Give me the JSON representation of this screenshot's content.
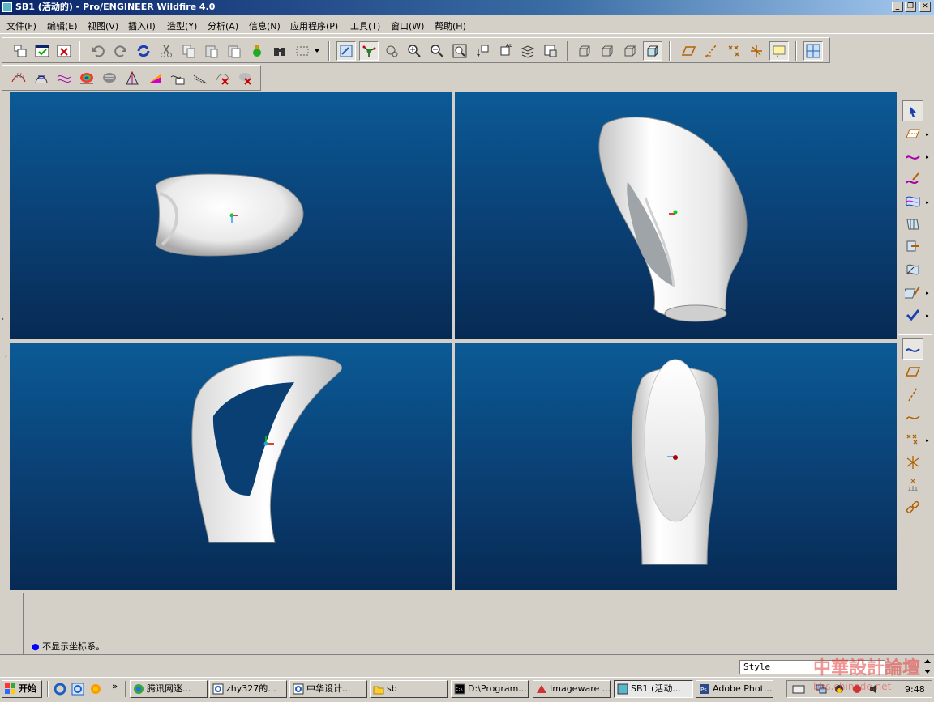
{
  "window": {
    "title": "SB1 (活动的) - Pro/ENGINEER Wildfire 4.0"
  },
  "menu": [
    {
      "label": "文件(F)"
    },
    {
      "label": "编辑(E)"
    },
    {
      "label": "视图(V)"
    },
    {
      "label": "插入(I)"
    },
    {
      "label": "造型(Y)"
    },
    {
      "label": "分析(A)"
    },
    {
      "label": "信息(N)"
    },
    {
      "label": "应用程序(P)"
    },
    {
      "label": "工具(T)"
    },
    {
      "label": "窗口(W)"
    },
    {
      "label": "帮助(H)"
    }
  ],
  "toolbar_main": [
    "new-window-icon",
    "save-icon",
    "close-window-icon",
    "undo-icon",
    "redo-icon",
    "regenerate-icon",
    "cut-icon",
    "copy-icon",
    "paste-icon",
    "paste-special-icon",
    "model-tree-icon",
    "find-icon",
    "select-box-icon",
    "repaint-icon",
    "spin-center-icon",
    "orient-icon",
    "zoom-in-icon",
    "zoom-out-icon",
    "refit-icon",
    "reorient-icon",
    "saved-views-icon",
    "layers-icon",
    "view-manager-icon",
    "wireframe-icon",
    "hidden-line-icon",
    "no-hidden-icon",
    "shaded-icon",
    "datum-planes-icon",
    "datum-axes-icon",
    "datum-points-icon",
    "datum-csys-icon",
    "annotations-icon",
    "multi-view-icon"
  ],
  "toolbar_analysis": [
    "curvature-icon",
    "section-icon",
    "offset-icon",
    "shaded-curvature-icon",
    "reflection-icon",
    "draft-icon",
    "slope-icon",
    "curve-analysis-icon",
    "dihedral-icon",
    "delete-analysis-icon",
    "delete-all-analysis-icon"
  ],
  "right_tools": [
    "select-icon",
    "internal-plane-icon",
    "curve-icon",
    "edit-curve-icon",
    "surface-icon",
    "connect-surface-icon",
    "trim-surface-icon",
    "edit-surface-icon",
    "style-surface-icon",
    "done-check-icon",
    "datum-curve-icon",
    "datum-plane-icon",
    "datum-axis-icon",
    "sketched-curve-icon",
    "datum-point-icon",
    "intersect-point-icon",
    "csys-icon",
    "chain-icon"
  ],
  "message": "不显示坐标系。",
  "style_field": "Style",
  "taskbar": {
    "start_label": "开始",
    "tasks": [
      {
        "label": "腾讯网迷..."
      },
      {
        "label": "zhy327的..."
      },
      {
        "label": "中华设计..."
      },
      {
        "label": "sb"
      },
      {
        "label": "D:\\Program..."
      },
      {
        "label": "Imageware ..."
      },
      {
        "label": "SB1 (活动..."
      },
      {
        "label": "Adobe Phot..."
      }
    ],
    "clock": "9:48"
  },
  "colors": {
    "viewport_top": "#0b5a96",
    "viewport_bottom": "#072a54",
    "title_start": "#0a246a",
    "title_end": "#a6caf0"
  }
}
